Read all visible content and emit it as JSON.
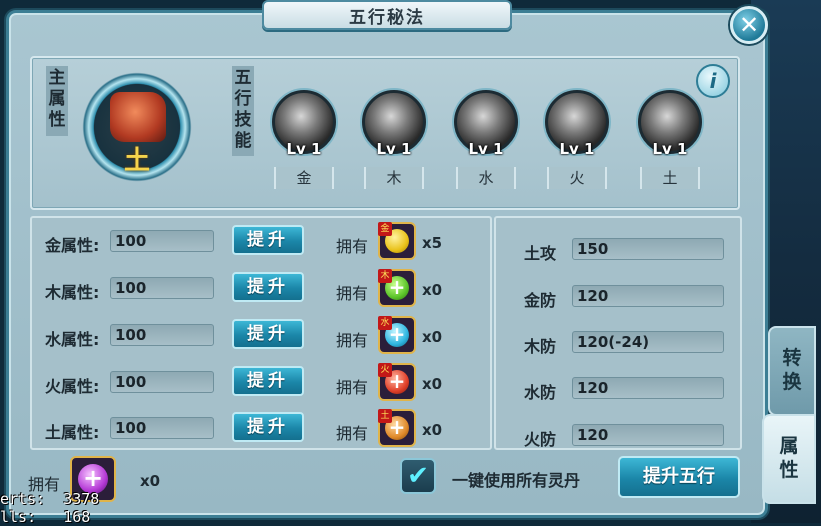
{
  "title": "五行秘法",
  "close_symbol": "✕",
  "info_symbol": "i",
  "main_attr_label": "主属性",
  "main_attr_element": "土",
  "skills_label": "五行技能",
  "skills": [
    {
      "level": "Lv 1",
      "name": "金"
    },
    {
      "level": "Lv 1",
      "name": "木"
    },
    {
      "level": "Lv 1",
      "name": "水"
    },
    {
      "level": "Lv 1",
      "name": "火"
    },
    {
      "level": "Lv 1",
      "name": "土"
    }
  ],
  "attributes": [
    {
      "label": "金属性:",
      "value": "100",
      "button": "提升",
      "own_label": "拥有",
      "pill_tag": "金",
      "pill_color": "#e9c21a",
      "pill_symbol": "",
      "count": "x5"
    },
    {
      "label": "木属性:",
      "value": "100",
      "button": "提升",
      "own_label": "拥有",
      "pill_tag": "木",
      "pill_color": "#5cc52a",
      "pill_symbol": "+",
      "count": "x0"
    },
    {
      "label": "水属性:",
      "value": "100",
      "button": "提升",
      "own_label": "拥有",
      "pill_tag": "水",
      "pill_color": "#2fb6e0",
      "pill_symbol": "+",
      "count": "x0"
    },
    {
      "label": "火属性:",
      "value": "100",
      "button": "提升",
      "own_label": "拥有",
      "pill_tag": "火",
      "pill_color": "#e0402a",
      "pill_symbol": "+",
      "count": "x0"
    },
    {
      "label": "土属性:",
      "value": "100",
      "button": "提升",
      "own_label": "拥有",
      "pill_tag": "土",
      "pill_color": "#e08a2a",
      "pill_symbol": "+",
      "count": "x0"
    }
  ],
  "stats": [
    {
      "label": "土攻",
      "value": "150"
    },
    {
      "label": "金防",
      "value": "120"
    },
    {
      "label": "木防",
      "value": "120(-24)"
    },
    {
      "label": "水防",
      "value": "120"
    },
    {
      "label": "火防",
      "value": "120"
    }
  ],
  "bottom": {
    "own_label": "拥有",
    "pill_symbol": "+",
    "count": "x0",
    "check_symbol": "✔",
    "use_all_label": "一键使用所有灵丹",
    "upgrade_button": "提升五行"
  },
  "tabs": [
    {
      "label": "转换"
    },
    {
      "label": "属性"
    }
  ],
  "debug_lines": [
    "erts:  3378",
    "lls:   168"
  ]
}
